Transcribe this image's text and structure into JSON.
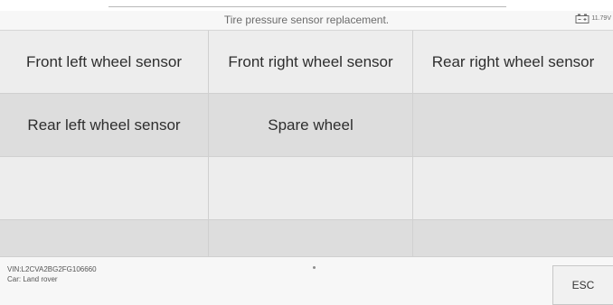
{
  "header": {
    "title": "Tire pressure sensor replacement.",
    "battery_voltage": "11.79V",
    "battery_icon": "battery-icon"
  },
  "menu": {
    "items": [
      {
        "label": "Front left wheel sensor"
      },
      {
        "label": "Front right wheel sensor"
      },
      {
        "label": "Rear right wheel sensor"
      },
      {
        "label": "Rear left wheel sensor"
      },
      {
        "label": "Spare wheel"
      }
    ]
  },
  "footer": {
    "vin": "VIN:L2CVA2BG2FG106660",
    "car": "Car: Land rover",
    "esc_label": "ESC"
  },
  "colors": {
    "row_light": "#ededed",
    "row_dark": "#dddddd",
    "bar": "#f7f7f7"
  }
}
